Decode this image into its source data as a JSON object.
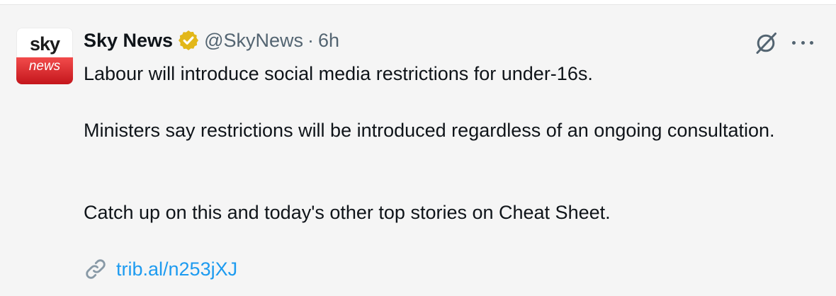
{
  "avatar": {
    "top": "sky",
    "bottom": "news"
  },
  "header": {
    "name": "Sky News",
    "handle": "@SkyNews",
    "separator": "·",
    "time": "6h"
  },
  "tweet": {
    "paragraphs": [
      "Labour will introduce social media restrictions for under-16s.",
      "Ministers say restrictions will be introduced regardless of an ongoing consultation.",
      "Catch up on this and today's other top stories on Cheat Sheet."
    ],
    "link": "trib.al/n253jXJ"
  },
  "icons": {
    "verified": "verified-badge-icon",
    "grok": "grok-icon",
    "more": "more-icon",
    "link": "link-icon"
  },
  "colors": {
    "link": "#1d9bf0",
    "verified": "#e2b719",
    "avatar_red": "#d7262b"
  }
}
